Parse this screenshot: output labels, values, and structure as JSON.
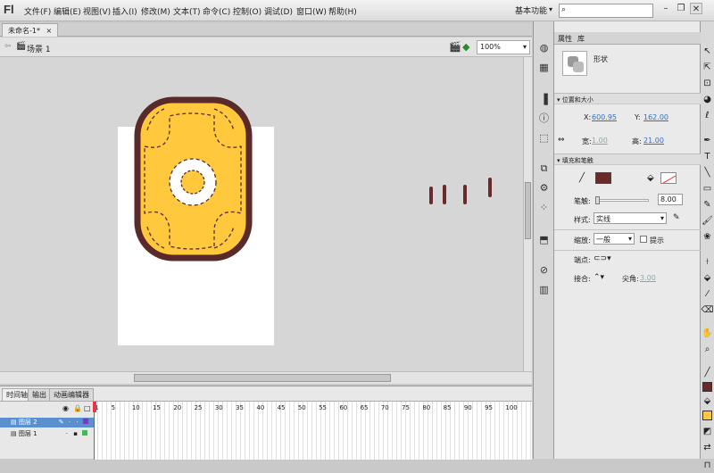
{
  "app": {
    "logo": "Fl"
  },
  "menu": [
    "文件(F)",
    "编辑(E)",
    "视图(V)",
    "插入(I)",
    "修改(M)",
    "文本(T)",
    "命令(C)",
    "控制(O)",
    "调试(D)",
    "窗口(W)",
    "帮助(H)"
  ],
  "workspace": {
    "label": "基本功能",
    "search_placeholder": ""
  },
  "document": {
    "tab": "未命名-1*",
    "close": "×",
    "scene": "场景 1",
    "zoom": "100%"
  },
  "timeline": {
    "tabs": [
      "时间轴",
      "输出",
      "动画编辑器"
    ],
    "frame_numbers": [
      "1",
      "5",
      "10",
      "15",
      "20",
      "25",
      "30",
      "35",
      "40",
      "45",
      "50",
      "55",
      "60",
      "65",
      "70",
      "75",
      "80",
      "85",
      "90",
      "95",
      "100"
    ],
    "layers": [
      {
        "name": "图层 2",
        "selected": true
      },
      {
        "name": "图层 1",
        "selected": false
      }
    ]
  },
  "properties": {
    "tabs": [
      "属性",
      "库"
    ],
    "object_type": "形状",
    "sections": {
      "position_size": "位置和大小",
      "fill_stroke": "填充和笔触"
    },
    "x_label": "X:",
    "x": "600.95",
    "y_label": "Y:",
    "y": "162.00",
    "w_label": "宽:",
    "w": "1.00",
    "h_label": "高:",
    "h": "21.00",
    "stroke_label": "笔触:",
    "stroke": "8.00",
    "style_label": "样式:",
    "style": "实线",
    "scale_label": "缩放:",
    "scale": "一般",
    "hint": "提示",
    "cap_label": "端点:",
    "join_label": "接合:",
    "miter_label": "尖角:",
    "miter": "3.00",
    "stroke_color": "#6b2a2a"
  },
  "colors": {
    "fill": "#ffc83d",
    "stroke": "#5a2a2a",
    "accent": "#3c7fd0"
  }
}
